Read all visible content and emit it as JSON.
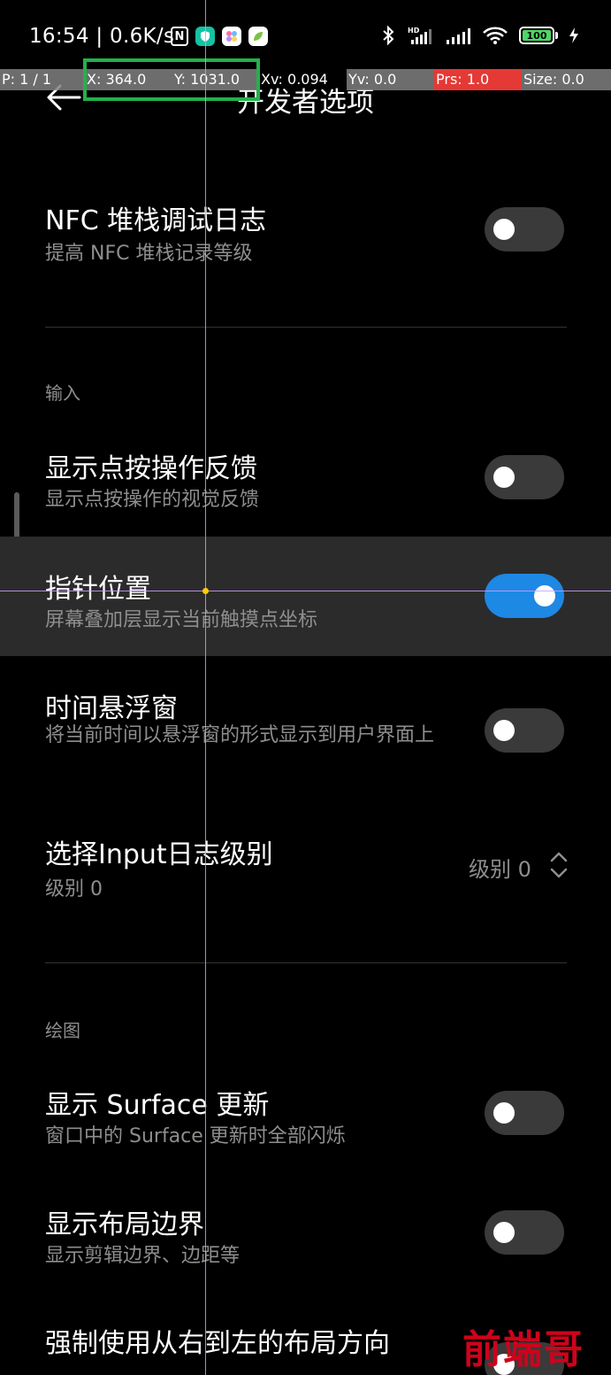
{
  "status_bar": {
    "time": "16:54 | 0.6K/s",
    "battery": "100"
  },
  "pointer_overlay": {
    "pointers": "P: 1 / 1",
    "x": "X: 364.0",
    "y": "Y: 1031.0",
    "xv": "Xv: 0.094",
    "yv": "Yv: 0.0",
    "prs": "Prs: 1.0",
    "size": "Size: 0.0",
    "colors": {
      "gray": "#808080",
      "red": "#e53935",
      "highlight": "#22b14c"
    }
  },
  "header": {
    "title": "开发者选项"
  },
  "settings": {
    "nfc_log": {
      "title": "NFC 堆栈调试日志",
      "subtitle": "提高 NFC 堆栈记录等级",
      "enabled": false
    },
    "section_input": "输入",
    "show_taps": {
      "title": "显示点按操作反馈",
      "subtitle": "显示点按操作的视觉反馈",
      "enabled": false
    },
    "pointer_location": {
      "title": "指针位置",
      "subtitle": "屏幕叠加层显示当前触摸点坐标",
      "enabled": true
    },
    "time_float": {
      "title": "时间悬浮窗",
      "subtitle": "将当前时间以悬浮窗的形式显示到用户界面上",
      "enabled": false
    },
    "input_log_level": {
      "title": "选择Input日志级别",
      "subtitle": "级别 0",
      "value": "级别 0"
    },
    "section_drawing": "绘图",
    "surface_updates": {
      "title": "显示 Surface 更新",
      "subtitle": "窗口中的 Surface 更新时全部闪烁",
      "enabled": false
    },
    "layout_bounds": {
      "title": "显示布局边界",
      "subtitle": "显示剪辑边界、边距等",
      "enabled": false
    },
    "force_rtl": {
      "title": "强制使用从右到左的布局方向",
      "enabled": false
    }
  },
  "watermark": "前端哥",
  "accent_color": "#1e88e5"
}
